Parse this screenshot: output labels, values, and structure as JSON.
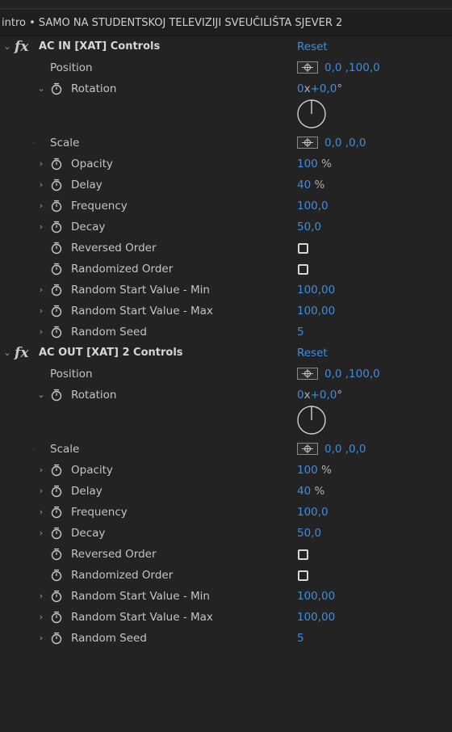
{
  "header": {
    "title": "intro • SAMO NA  STUDENTSKOJ TELEVIZIJI  SVEUČILIŠTA SJEVER 2"
  },
  "colors": {
    "background": "#232323",
    "value_blue": "#3e8ede",
    "label": "#c4c4c4"
  },
  "icons": {
    "twirl_open": "chevron-down-icon",
    "twirl_closed": "chevron-right-icon",
    "stopwatch": "stopwatch-icon",
    "anchor": "crosshair-icon",
    "effect": "fx-icon"
  },
  "effects": [
    {
      "name": "AC IN [XAT] Controls",
      "reset": "Reset",
      "position": {
        "label": "Position",
        "value": "0,0 ,100,0"
      },
      "rotation": {
        "label": "Rotation",
        "revs": "0",
        "x": "x",
        "deg": "+0,0",
        "unit": "°"
      },
      "scale": {
        "label": "Scale",
        "value": "0,0 ,0,0"
      },
      "opacity": {
        "label": "Opacity",
        "value": "100",
        "unit": "%"
      },
      "delay": {
        "label": "Delay",
        "value": "40",
        "unit": "%"
      },
      "frequency": {
        "label": "Frequency",
        "value": "100,0"
      },
      "decay": {
        "label": "Decay",
        "value": "50,0"
      },
      "reversed": {
        "label": "Reversed Order"
      },
      "randomized": {
        "label": "Randomized Order"
      },
      "min": {
        "label": "Random Start Value - Min",
        "value": "100,00"
      },
      "max": {
        "label": "Random Start Value - Max",
        "value": "100,00"
      },
      "seed": {
        "label": "Random Seed",
        "value": "5"
      }
    },
    {
      "name": "AC OUT [XAT] 2 Controls",
      "reset": "Reset",
      "position": {
        "label": "Position",
        "value": "0,0 ,100,0"
      },
      "rotation": {
        "label": "Rotation",
        "revs": "0",
        "x": "x",
        "deg": "+0,0",
        "unit": "°"
      },
      "scale": {
        "label": "Scale",
        "value": "0,0 ,0,0"
      },
      "opacity": {
        "label": "Opacity",
        "value": "100",
        "unit": "%"
      },
      "delay": {
        "label": "Delay",
        "value": "40",
        "unit": "%"
      },
      "frequency": {
        "label": "Frequency",
        "value": "100,0"
      },
      "decay": {
        "label": "Decay",
        "value": "50,0"
      },
      "reversed": {
        "label": "Reversed Order"
      },
      "randomized": {
        "label": "Randomized Order"
      },
      "min": {
        "label": "Random Start Value - Min",
        "value": "100,00"
      },
      "max": {
        "label": "Random Start Value - Max",
        "value": "100,00"
      },
      "seed": {
        "label": "Random Seed",
        "value": "5"
      }
    }
  ]
}
